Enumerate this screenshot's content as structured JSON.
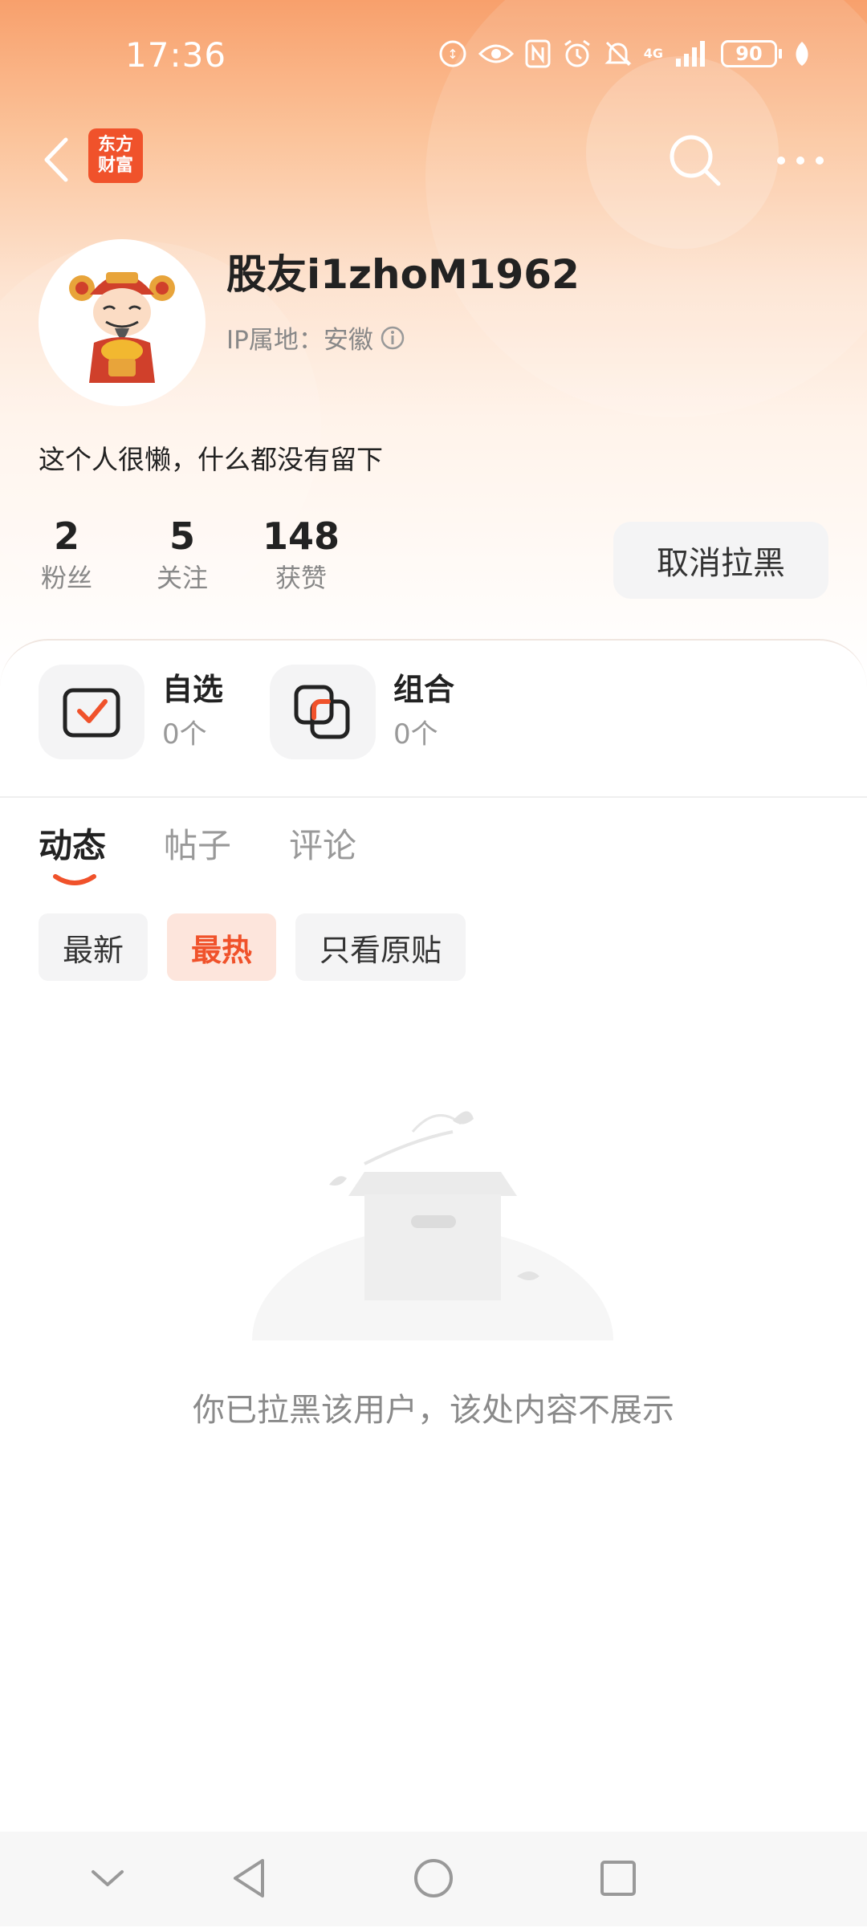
{
  "status_bar": {
    "time": "17:36",
    "network": "4G",
    "battery": "90"
  },
  "nav": {
    "logo_line1": "东方",
    "logo_line2": "财富"
  },
  "profile": {
    "username": "股友i1zhoM1962",
    "ip_label": "IP属地：安徽",
    "bio": "这个人很懒，什么都没有留下"
  },
  "stats": [
    {
      "value": "2",
      "label": "粉丝"
    },
    {
      "value": "5",
      "label": "关注"
    },
    {
      "value": "148",
      "label": "获赞"
    }
  ],
  "unblock_label": "取消拉黑",
  "tools": [
    {
      "title": "自选",
      "count": "0个"
    },
    {
      "title": "组合",
      "count": "0个"
    }
  ],
  "tabs": [
    "动态",
    "帖子",
    "评论"
  ],
  "filters": [
    "最新",
    "最热",
    "只看原贴"
  ],
  "empty_message": "你已拉黑该用户，该处内容不展示",
  "colors": {
    "accent": "#f0522b",
    "header_gradient_top": "#f8a06c"
  }
}
